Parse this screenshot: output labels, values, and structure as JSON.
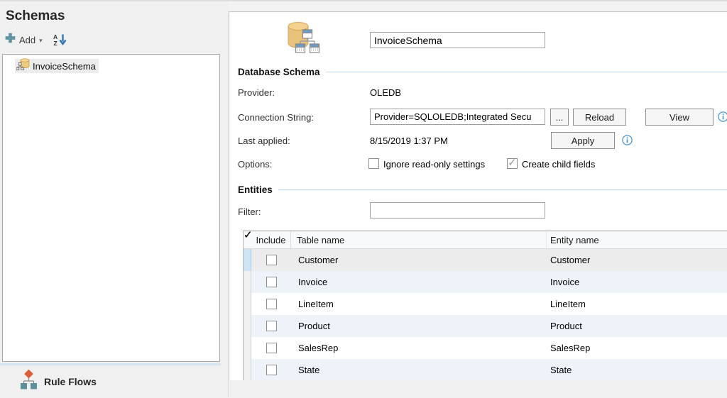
{
  "sidebar": {
    "title": "Schemas",
    "toolbar": {
      "add_label": "Add",
      "add_caret": "▾"
    },
    "tree": {
      "items": [
        {
          "label": "InvoiceSchema",
          "selected": true
        }
      ]
    },
    "rule_flows_label": "Rule Flows"
  },
  "main": {
    "schema_name": "InvoiceSchema",
    "sections": {
      "database_schema": "Database Schema",
      "entities": "Entities"
    },
    "fields": {
      "provider_label": "Provider:",
      "provider_value": "OLEDB",
      "connection_label": "Connection String:",
      "connection_value": "Provider=SQLOLEDB;Integrated Secu",
      "browse_label": "...",
      "reload_label": "Reload",
      "view_label": "View",
      "last_applied_label": "Last applied:",
      "last_applied_value": "8/15/2019 1:37 PM",
      "apply_label": "Apply",
      "options_label": "Options:",
      "option_ignore_readonly": {
        "label": "Ignore read-only settings",
        "checked": false
      },
      "option_create_child": {
        "label": "Create child fields",
        "checked": true
      },
      "filter_label": "Filter:",
      "filter_value": ""
    },
    "table": {
      "columns": [
        "Include",
        "Table name",
        "Entity name"
      ],
      "rows": [
        {
          "include": true,
          "table_name": "Customer",
          "entity_name": "Customer",
          "selected": true
        },
        {
          "include": true,
          "table_name": "Invoice",
          "entity_name": "Invoice",
          "selected": false
        },
        {
          "include": true,
          "table_name": "LineItem",
          "entity_name": "LineItem",
          "selected": false
        },
        {
          "include": true,
          "table_name": "Product",
          "entity_name": "Product",
          "selected": false
        },
        {
          "include": true,
          "table_name": "SalesRep",
          "entity_name": "SalesRep",
          "selected": false
        },
        {
          "include": true,
          "table_name": "State",
          "entity_name": "State",
          "selected": false
        }
      ]
    }
  },
  "icons": {
    "add-plus-icon": {
      "glyph": "plus",
      "color": "#5e93a5"
    },
    "sort-az-icon": {
      "glyph": "A/Z with down arrow",
      "color": "#2e74b5"
    },
    "schema-tree-icon": {
      "glyph": "database cylinder with hierarchy",
      "colors": [
        "#f0cd7e",
        "#8a8a8a"
      ]
    },
    "database-schema-icon": {
      "glyph": "database cylinder with hierarchy windows",
      "colors": [
        "#e9c37c",
        "#6d9bc3"
      ]
    },
    "rule-flows-icon": {
      "glyph": "flowchart diamond over two squares",
      "colors": [
        "#d95f3b",
        "#5f8e9c"
      ]
    },
    "info-icon": {
      "glyph": "i in circle",
      "color": "#4a96d2"
    },
    "checkmark": {
      "glyph": "✓"
    }
  },
  "colors": {
    "app_background": "#f0f0f0",
    "panel_background": "#ffffff",
    "section_rule": "#bdd6ea",
    "selected_row": "#ececec",
    "alt_row": "#eef3f9",
    "selected_gutter": "#cfe4f5"
  }
}
